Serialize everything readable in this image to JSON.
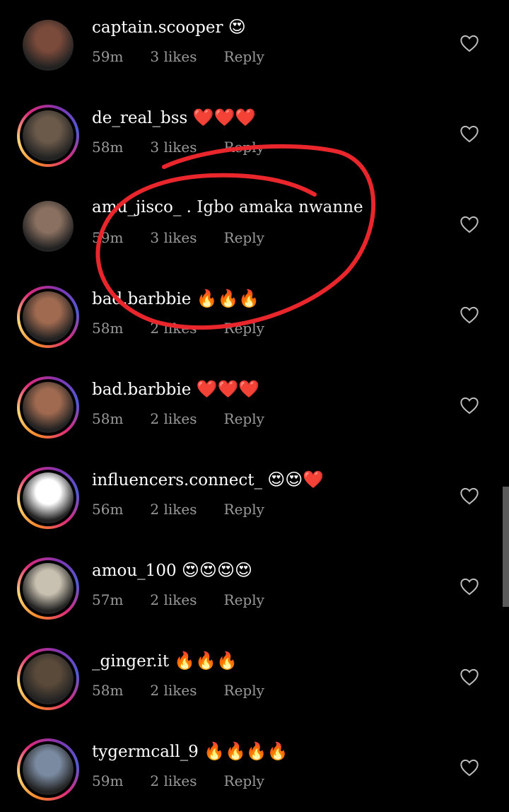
{
  "comments": [
    {
      "username": "captain.scooper",
      "body": "",
      "emoji": "😍",
      "time": "59m",
      "likes": "3 likes",
      "reply": "Reply",
      "avatar_color": "#7a4a3a",
      "ring": false
    },
    {
      "username": "de_real_bss",
      "body": "",
      "emoji": "❤️❤️❤️",
      "time": "58m",
      "likes": "3 likes",
      "reply": "Reply",
      "avatar_color": "#6b5a4a",
      "ring": true
    },
    {
      "username": "amu_jisco_",
      "body": ". Igbo amaka nwanne",
      "emoji": "",
      "time": "59m",
      "likes": "3 likes",
      "reply": "Reply",
      "avatar_color": "#8a7060",
      "ring": false
    },
    {
      "username": "bad.barbbie",
      "body": "",
      "emoji": "🔥🔥🔥",
      "time": "58m",
      "likes": "2 likes",
      "reply": "Reply",
      "avatar_color": "#a06a50",
      "ring": true
    },
    {
      "username": "bad.barbbie",
      "body": "",
      "emoji": "❤️❤️❤️",
      "time": "58m",
      "likes": "2 likes",
      "reply": "Reply",
      "avatar_color": "#a06a50",
      "ring": true
    },
    {
      "username": "influencers.connect_",
      "body": "",
      "emoji": "😍😍❤️",
      "time": "56m",
      "likes": "2 likes",
      "reply": "Reply",
      "avatar_color": "#ffffff",
      "ring": true
    },
    {
      "username": "amou_100",
      "body": "",
      "emoji": "😍😍😍😍",
      "time": "57m",
      "likes": "2 likes",
      "reply": "Reply",
      "avatar_color": "#c8c0b0",
      "ring": true
    },
    {
      "username": "_ginger.it",
      "body": "",
      "emoji": "🔥🔥🔥",
      "time": "58m",
      "likes": "2 likes",
      "reply": "Reply",
      "avatar_color": "#5a4a3a",
      "ring": true
    },
    {
      "username": "tygermcall_9",
      "body": "",
      "emoji": "🔥🔥🔥🔥",
      "time": "59m",
      "likes": "2 likes",
      "reply": "Reply",
      "avatar_color": "#7a8aa0",
      "ring": true
    }
  ],
  "colors": {
    "background": "#000000",
    "meta_text": "#9a9a9a",
    "annotation_red": "#e8262c",
    "scrollbar": "#5a5a5a"
  },
  "icons": {
    "like": "heart-outline-icon",
    "annotation": "red-hand-drawn-circle"
  }
}
